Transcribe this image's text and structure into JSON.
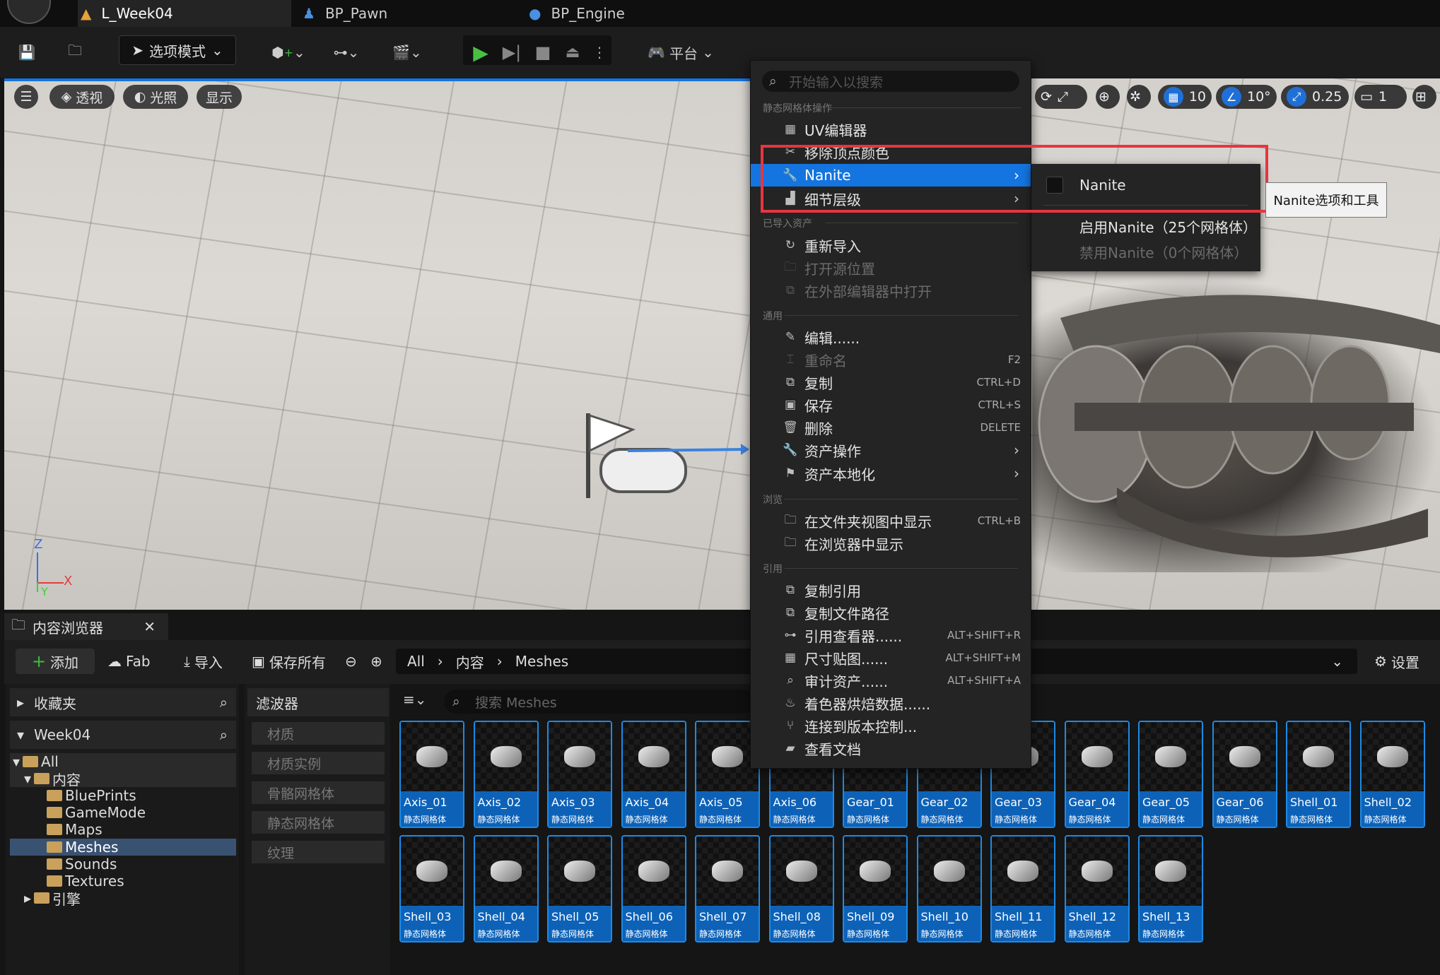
{
  "tabs": [
    {
      "label": "L_Week04",
      "icon": "level-icon",
      "active": true
    },
    {
      "label": "BP_Pawn",
      "icon": "pawn-icon",
      "active": false
    },
    {
      "label": "BP_Engine",
      "icon": "blueprint-icon",
      "active": false
    }
  ],
  "toolbar": {
    "mode_label": "选项模式",
    "platform_label": "平台"
  },
  "viewport": {
    "perspective": "透视",
    "lighting": "光照",
    "show": "显示",
    "grid_snap": "10",
    "rotation_snap": "10°",
    "scale_snap": "0.25",
    "camera_speed": "1",
    "axis": {
      "z": "Z",
      "x": "X",
      "y": "Y"
    }
  },
  "context_menu": {
    "search_placeholder": "开始输入以搜索",
    "sections": {
      "static_mesh_ops": "静态网格体操作",
      "imported_asset": "已导入资产",
      "common": "通用",
      "browse": "浏览",
      "references": "引用"
    },
    "items": {
      "uv_editor": "UV编辑器",
      "remove_vertex_colors": "移除顶点颜色",
      "nanite": "Nanite",
      "lod": "细节层级",
      "reimport": "重新导入",
      "open_source_location": "打开源位置",
      "open_in_external_editor": "在外部编辑器中打开",
      "edit": "编辑......",
      "rename": "重命名",
      "rename_sc": "F2",
      "duplicate": "复制",
      "duplicate_sc": "CTRL+D",
      "save": "保存",
      "save_sc": "CTRL+S",
      "delete": "删除",
      "delete_sc": "DELETE",
      "asset_actions": "资产操作",
      "asset_localization": "资产本地化",
      "show_in_folder_view": "在文件夹视图中显示",
      "show_in_folder_view_sc": "CTRL+B",
      "show_in_explorer": "在浏览器中显示",
      "copy_reference": "复制引用",
      "copy_file_path": "复制文件路径",
      "reference_viewer": "引用查看器......",
      "reference_viewer_sc": "ALT+SHIFT+R",
      "size_map": "尺寸贴图......",
      "size_map_sc": "ALT+SHIFT+M",
      "audit_assets": "审计资产......",
      "audit_assets_sc": "ALT+SHIFT+A",
      "shader_cook": "着色器烘焙数据......",
      "connect_source_control": "连接到版本控制...",
      "view_docs": "查看文档"
    }
  },
  "nanite_submenu": {
    "checkbox_label": "Nanite",
    "enable": "启用Nanite（25个网格体）",
    "disable": "禁用Nanite（0个网格体）",
    "tooltip": "Nanite选项和工具"
  },
  "content_browser": {
    "tab_title": "内容浏览器",
    "add": "添加",
    "fab": "Fab",
    "import": "导入",
    "save_all": "保存所有",
    "path": [
      "All",
      "内容",
      "Meshes"
    ],
    "settings": "设置",
    "favorites": "收藏夹",
    "project": "Week04",
    "tree": [
      "All",
      "内容",
      "BluePrints",
      "GameMode",
      "Maps",
      "Meshes",
      "Sounds",
      "Textures",
      "引擎"
    ],
    "filters_title": "滤波器",
    "filters": [
      "材质",
      "材质实例",
      "骨骼网格体",
      "静态网格体",
      "纹理"
    ],
    "search_placeholder": "搜索 Meshes",
    "asset_type": "静态网格体",
    "assets_row1": [
      "Axis_01",
      "Axis_02",
      "Axis_03",
      "Axis_04",
      "Axis_05",
      "Axis_06",
      "Gear_01",
      "Gear_02",
      "Gear_03",
      "Gear_04",
      "Gear_05",
      "Gear_06",
      "Shell_01",
      "Shell_02"
    ],
    "assets_row2": [
      "Shell_03",
      "Shell_04",
      "Shell_05",
      "Shell_06",
      "Shell_07",
      "Shell_08",
      "Shell_09",
      "Shell_10",
      "Shell_11",
      "Shell_12",
      "Shell_13"
    ]
  }
}
